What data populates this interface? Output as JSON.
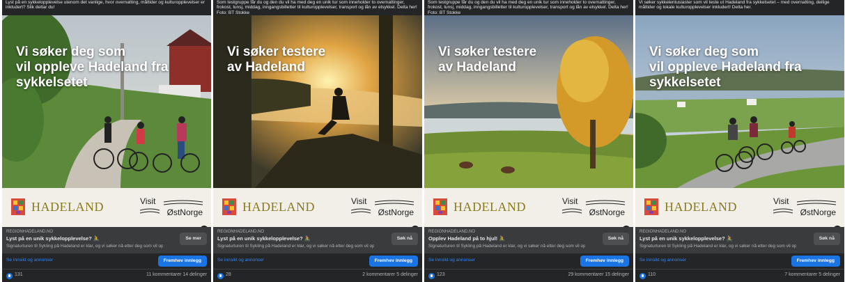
{
  "cards": [
    {
      "caption": "Lyst på en sykkelopplevelse utenom det vanlige, hvor overnatting, måltider og kulturopplevelser er inkludert? Slik deltar du!",
      "headline": "Vi søker deg som\nvil oppleve Hadeland fra\nsykkelsetet",
      "brand": "HADELAND",
      "visit_top": "Visit",
      "visit_bottom": "ØstNorge",
      "domain": "REGIONHADELAND.NO",
      "link_title": "Lyst på en unik sykkelopplevelse? 🚴",
      "link_desc": "Signaturturen til Sykling på Hadeland er klar, og vi søker nå etter deg som vil opp...",
      "cta": "Se mer",
      "insights": "Se innsikt og annonser",
      "boost": "Fremhev innlegg",
      "likes": "131",
      "comments": "11 kommentarer  14 delinger"
    },
    {
      "caption": "Som testgruppe får du og den du vil ha med deg en unik tur som inneholder to overnattinger, frokost, lunsj, middag, inngangsbilletter til kulturopplevelser, transport og lån av elsykkel. Delta her! Foto: BT Stokke",
      "headline": "Vi søker testere\nav Hadeland",
      "brand": "HADELAND",
      "visit_top": "Visit",
      "visit_bottom": "ØstNorge",
      "domain": "REGIONHADELAND.NO",
      "link_title": "Lyst på en unik sykkelopplevelse? 🚴",
      "link_desc": "Signaturturen til Sykling på Hadeland er klar, og vi søker nå etter deg som vil opp...",
      "cta": "Søk nå",
      "insights": "Se innsikt og annonser",
      "boost": "Fremhev innlegg",
      "likes": "28",
      "comments": "2 kommentarer  5 delinger"
    },
    {
      "caption": "Som testgruppe får du og den du vil ha med deg en unik tur som inneholder to overnattinger, frokost, lunsj, middag, inngangsbilletter til kulturopplevelser, transport og lån av elsykkel. Delta her! Foto: BT Stokke",
      "headline": "Vi søker testere\nav Hadeland",
      "brand": "HADELAND",
      "visit_top": "Visit",
      "visit_bottom": "ØstNorge",
      "domain": "REGIONHADELAND.NO",
      "link_title": "Opplev Hadeland på to hjul! 🚴",
      "link_desc": "Signaturturen til Sykling på Hadeland er klar, og vi søker nå etter deg som vil opp...",
      "cta": "Søk nå",
      "insights": "Se innsikt og annonser",
      "boost": "Fremhev innlegg",
      "likes": "123",
      "comments": "29 kommentarer  15 delinger"
    },
    {
      "caption": "Vi søker sykkelentusiaster som vil teste ut Hadeland fra sykkelsetet – med overnatting, deilige måltider og lokale kulturopplevelser inkludert! Delta her.",
      "headline": "Vi søker deg som\nvil oppleve Hadeland fra\nsykkelsetet",
      "brand": "HADELAND",
      "visit_top": "Visit",
      "visit_bottom": "ØstNorge",
      "domain": "REGIONHADELAND.NO",
      "link_title": "Lyst på en unik sykkelopplevelse? 🚴",
      "link_desc": "Signaturturen til Sykling på Hadeland er klar, og vi søker nå etter deg som vil opp...",
      "cta": "Søk nå",
      "insights": "Se innsikt og annonser",
      "boost": "Fremhev innlegg",
      "likes": "110",
      "comments": "7 kommentarer  5 delinger"
    }
  ]
}
